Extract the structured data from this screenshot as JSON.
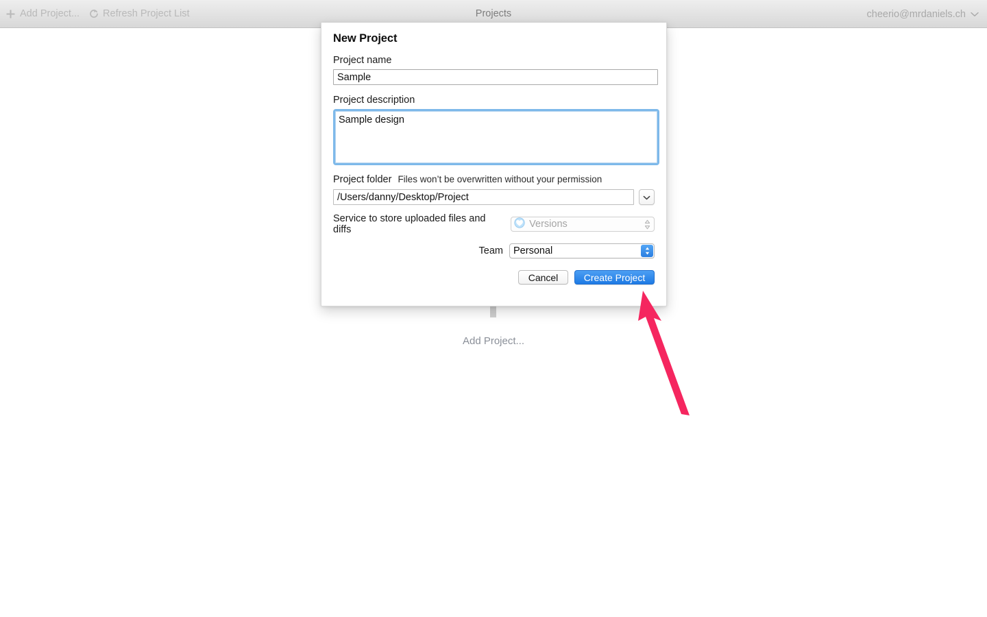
{
  "toolbar": {
    "add_project_label": "Add Project...",
    "add_project_icon": "plus-icon",
    "refresh_label": "Refresh Project List",
    "refresh_icon": "refresh-icon",
    "title": "Projects",
    "account_label": "cheerio@mrdaniels.ch",
    "account_chevron_icon": "chevron-down-icon"
  },
  "background": {
    "add_project_label": "Add Project..."
  },
  "dialog": {
    "title": "New Project",
    "project_name": {
      "label": "Project name",
      "value": "Sample",
      "placeholder": ""
    },
    "project_description": {
      "label": "Project description",
      "value": "Sample design",
      "placeholder": ""
    },
    "project_folder": {
      "label": "Project folder",
      "hint": "Files won’t be overwritten without your permission",
      "value": "/Users/danny/Desktop/Project",
      "placeholder": "",
      "browse_icon": "chevron-down-icon"
    },
    "service": {
      "label": "Service to store uploaded files and diffs",
      "selected": "Versions",
      "icon": "versions-icon",
      "disabled": true,
      "stepper_icon": "stepper-up-down-icon",
      "options": [
        "Versions"
      ]
    },
    "team": {
      "label": "Team",
      "selected": "Personal",
      "stepper_icon": "stepper-up-down-icon",
      "options": [
        "Personal"
      ]
    },
    "buttons": {
      "cancel": "Cancel",
      "create": "Create Project"
    }
  },
  "annotation": {
    "arrow_color": "#F5265F",
    "points_to": "create-project-button"
  },
  "colors": {
    "accent_blue": "#1E7AE4",
    "focus_ring": "#7EB9EA",
    "annotation_pink": "#F5265F",
    "toolbar_bg": "#E3E3E3"
  }
}
